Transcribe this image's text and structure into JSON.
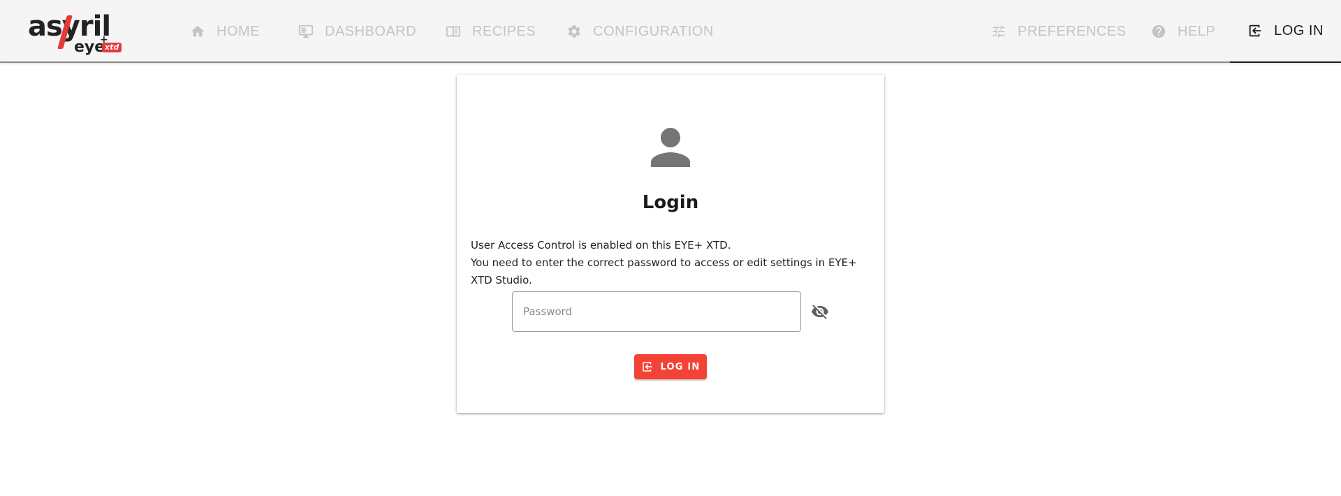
{
  "brand": {
    "name": "asyril",
    "product": "eye",
    "product_sup": "+",
    "edition": "xtd"
  },
  "nav": {
    "home": {
      "label": "HOME",
      "icon": "home-icon"
    },
    "dashboard": {
      "label": "DASHBOARD",
      "icon": "monitor-icon"
    },
    "recipes": {
      "label": "RECIPES",
      "icon": "recipe-book-icon"
    },
    "configuration": {
      "label": "CONFIGURATION",
      "icon": "gear-icon"
    },
    "preferences": {
      "label": "PREFERENCES",
      "icon": "sliders-icon"
    },
    "help": {
      "label": "HELP",
      "icon": "help-circle-icon"
    },
    "login": {
      "label": "LOG IN",
      "icon": "login-arrow-icon",
      "active": true
    }
  },
  "card": {
    "avatar_icon": "user-icon",
    "title": "Login",
    "description_lines": [
      "User Access Control is enabled on this EYE+ XTD.",
      "You need to enter the correct password to access or edit settings in EYE+ XTD Studio."
    ],
    "password": {
      "placeholder": "Password",
      "value": "",
      "visibility_icon": "eye-off-icon"
    },
    "login_button": {
      "label": "LOG IN",
      "icon": "login-arrow-icon"
    }
  },
  "colors": {
    "accent": "#f44336",
    "nav_inactive": "#c4c4c4",
    "nav_active": "#1c1c1c",
    "topbar_bg": "#f5f5f5"
  }
}
